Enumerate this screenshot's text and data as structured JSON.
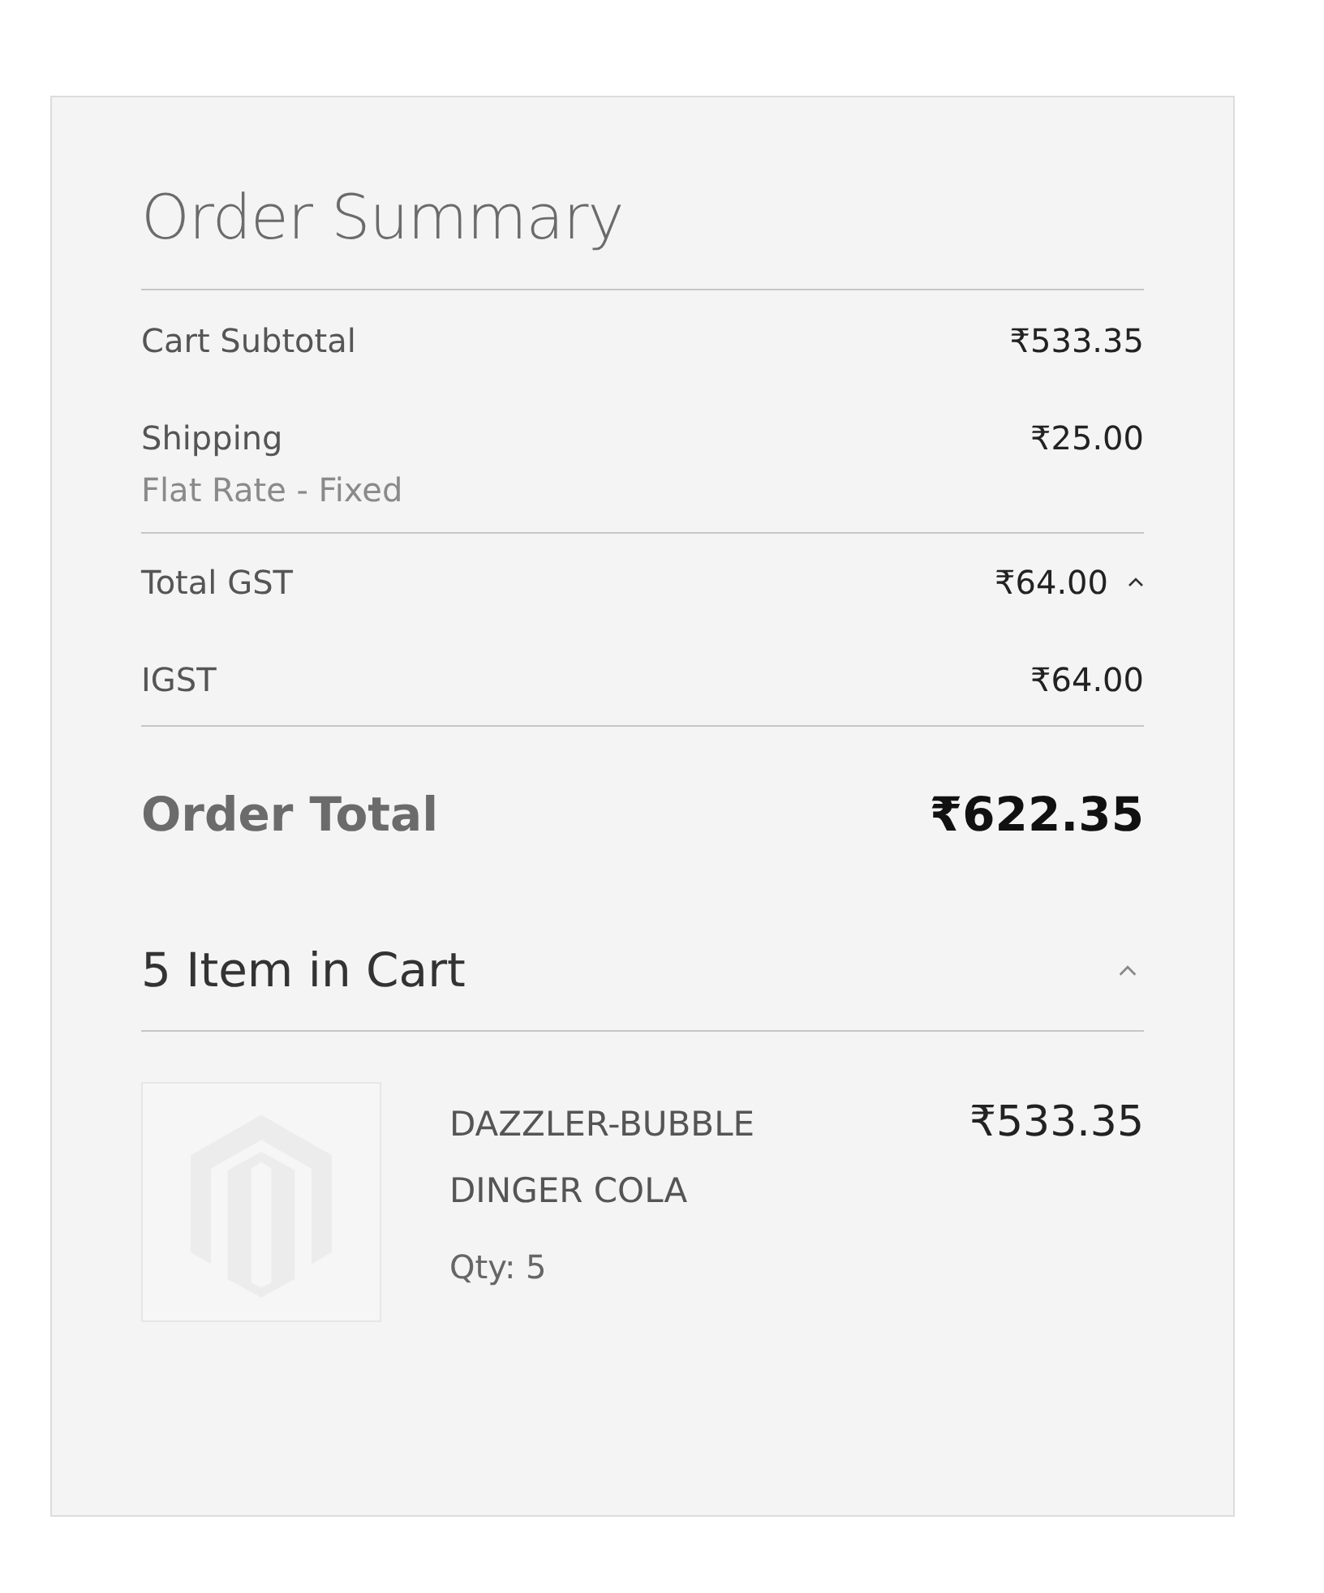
{
  "title": "Order Summary",
  "subtotal": {
    "label": "Cart Subtotal",
    "value": "₹533.35"
  },
  "shipping": {
    "label": "Shipping",
    "method": "Flat Rate - Fixed",
    "value": "₹25.00"
  },
  "tax": {
    "label": "Total GST",
    "value": "₹64.00",
    "expanded": true,
    "details": [
      {
        "label": "IGST",
        "value": "₹64.00"
      }
    ]
  },
  "order_total": {
    "label": "Order Total",
    "value": "₹622.35"
  },
  "cart": {
    "heading": "5 Item in Cart",
    "expanded": true,
    "items": [
      {
        "name": "DAZZLER-BUBBLE DINGER COLA",
        "qty": "Qty: 5",
        "price": "₹533.35"
      }
    ]
  }
}
